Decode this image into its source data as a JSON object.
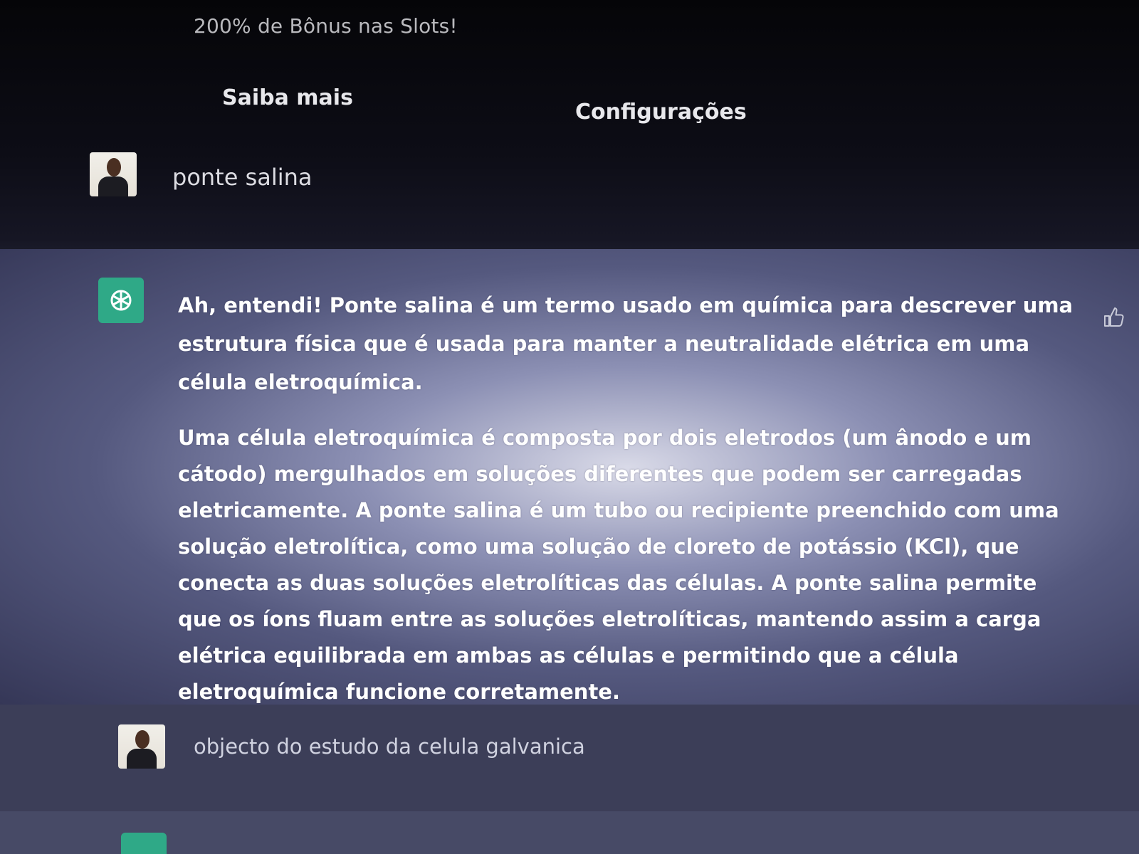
{
  "header": {
    "promo_text": "200% de Bônus nas Slots!",
    "learn_more_label": "Saiba mais",
    "settings_label": "Configurações"
  },
  "conversation": {
    "user_message_1": "ponte salina",
    "assistant_paragraph_1": "Ah, entendi! Ponte salina é um termo usado em química para descrever uma estrutura física que é usada para manter a neutralidade elétrica em uma célula eletroquímica.",
    "assistant_paragraph_2": "Uma célula eletroquímica é composta por dois eletrodos (um ânodo e um cátodo) mergulhados em soluções diferentes que podem ser carregadas eletricamente. A ponte salina é um tubo ou recipiente preenchido com uma solução eletrolítica, como uma solução de cloreto de potássio (KCl), que conecta as duas soluções eletrolíticas das células. A ponte salina permite que os íons fluam entre as soluções eletrolíticas, mantendo assim a carga elétrica equilibrada em ambas as células e permitindo que a célula eletroquímica funcione corretamente.",
    "user_message_2": "objecto do estudo da celula galvanica"
  },
  "icons": {
    "assistant_logo": "openai-logo-icon",
    "feedback": "thumbs-up-icon",
    "user_avatar": "user-avatar"
  },
  "colors": {
    "assistant_logo_bg": "#2fa987",
    "page_bg": "#0a0a10",
    "assistant_bg": "#55597f"
  }
}
